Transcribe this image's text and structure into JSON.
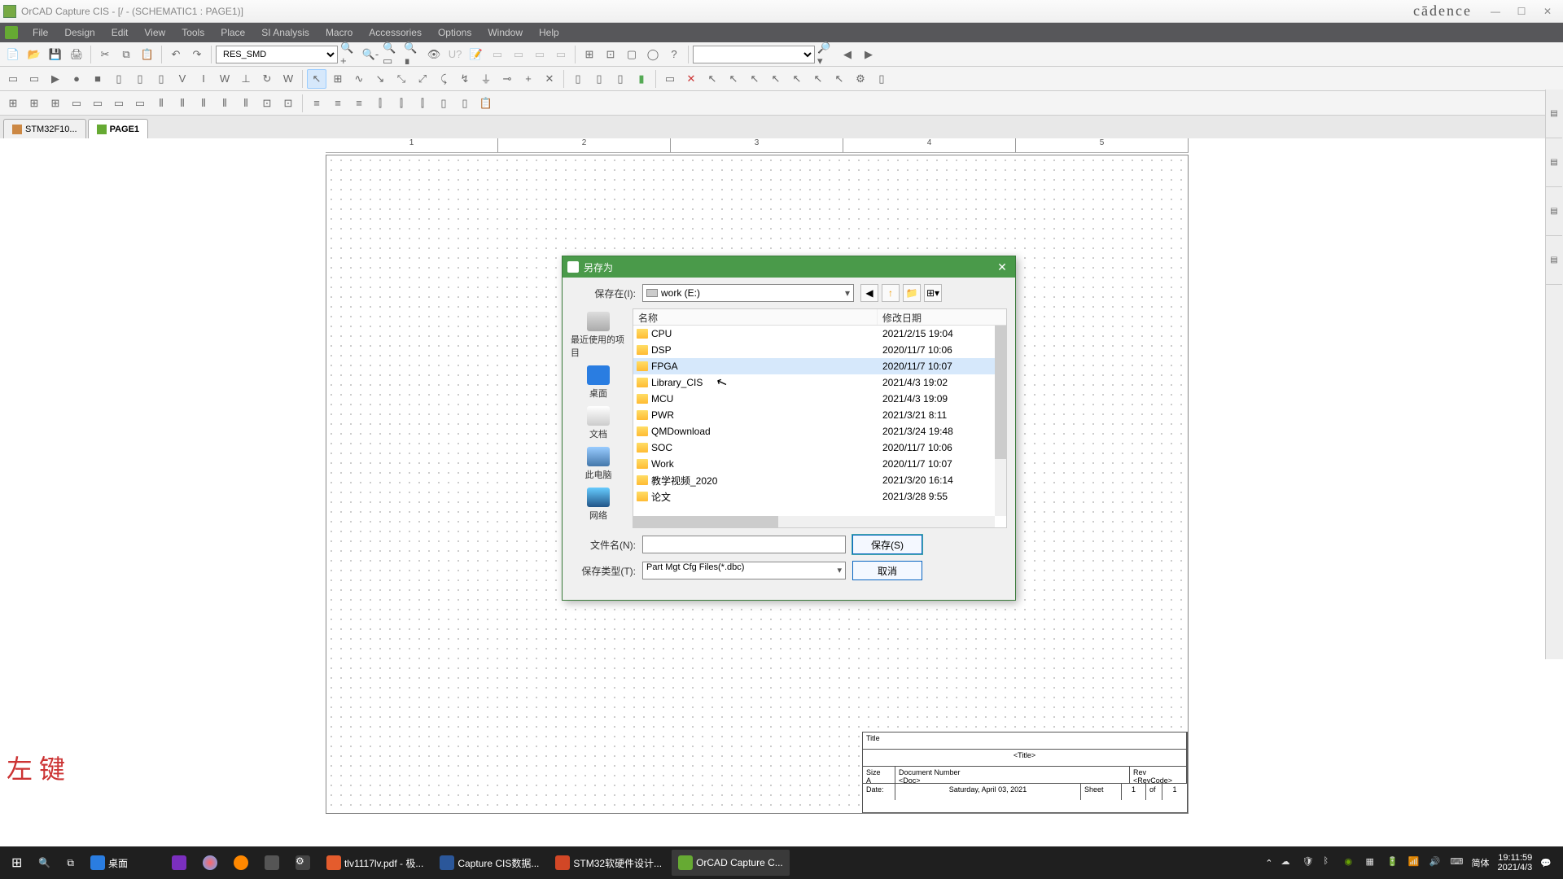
{
  "app": {
    "title": "OrCAD Capture CIS - [/ - (SCHEMATIC1 : PAGE1)]",
    "brand": "cādence"
  },
  "menu": [
    "File",
    "Design",
    "Edit",
    "View",
    "Tools",
    "Place",
    "SI Analysis",
    "Macro",
    "Accessories",
    "Options",
    "Window",
    "Help"
  ],
  "toolbar1": {
    "part_select": "RES_SMD"
  },
  "doc_tabs": [
    {
      "label": "STM32F10..."
    },
    {
      "label": "PAGE1"
    }
  ],
  "title_block": {
    "title_label": "Title",
    "title_value": "<Title>",
    "size_label": "Size",
    "size_value": "A",
    "docnum_label": "Document Number",
    "docnum_value": "<Doc>",
    "rev_label": "Rev",
    "rev_value": "<RevCode>",
    "date_label": "Date:",
    "date_value": "Saturday, April 03, 2021",
    "sheet_label": "Sheet",
    "sheet_cur": "1",
    "sheet_of": "of",
    "sheet_total": "1"
  },
  "watermark": "左 键",
  "dialog": {
    "title": "另存为",
    "save_in_label": "保存在(I):",
    "save_in_value": "work (E:)",
    "places": [
      "最近使用的项目",
      "桌面",
      "文档",
      "此电脑",
      "网络"
    ],
    "columns": {
      "name": "名称",
      "date": "修改日期"
    },
    "rows": [
      {
        "name": "CPU",
        "date": "2021/2/15 19:04"
      },
      {
        "name": "DSP",
        "date": "2020/11/7 10:06"
      },
      {
        "name": "FPGA",
        "date": "2020/11/7 10:07",
        "selected": true
      },
      {
        "name": "Library_CIS",
        "date": "2021/4/3 19:02"
      },
      {
        "name": "MCU",
        "date": "2021/4/3 19:09"
      },
      {
        "name": "PWR",
        "date": "2021/3/21 8:11"
      },
      {
        "name": "QMDownload",
        "date": "2021/3/24 19:48"
      },
      {
        "name": "SOC",
        "date": "2020/11/7 10:06"
      },
      {
        "name": "Work",
        "date": "2020/11/7 10:07"
      },
      {
        "name": "教学视频_2020",
        "date": "2021/3/20 16:14"
      },
      {
        "name": "论文",
        "date": "2021/3/28 9:55"
      }
    ],
    "filename_label": "文件名(N):",
    "filename_value": "",
    "filetype_label": "保存类型(T):",
    "filetype_value": "Part Mgt Cfg Files(*.dbc)",
    "save_btn": "保存(S)",
    "cancel_btn": "取消"
  },
  "taskbar": {
    "desktop_label": "桌面",
    "items": [
      {
        "label": "tlv1117lv.pdf - 极...",
        "color": "#e45c2d"
      },
      {
        "label": "Capture CIS数据...",
        "color": "#2b579a"
      },
      {
        "label": "STM32软硬件设计...",
        "color": "#d24726"
      },
      {
        "label": "OrCAD Capture C...",
        "color": "#6a3",
        "active": true
      }
    ],
    "ime": "简体",
    "time": "19:11:59",
    "date": "2021/4/3"
  }
}
